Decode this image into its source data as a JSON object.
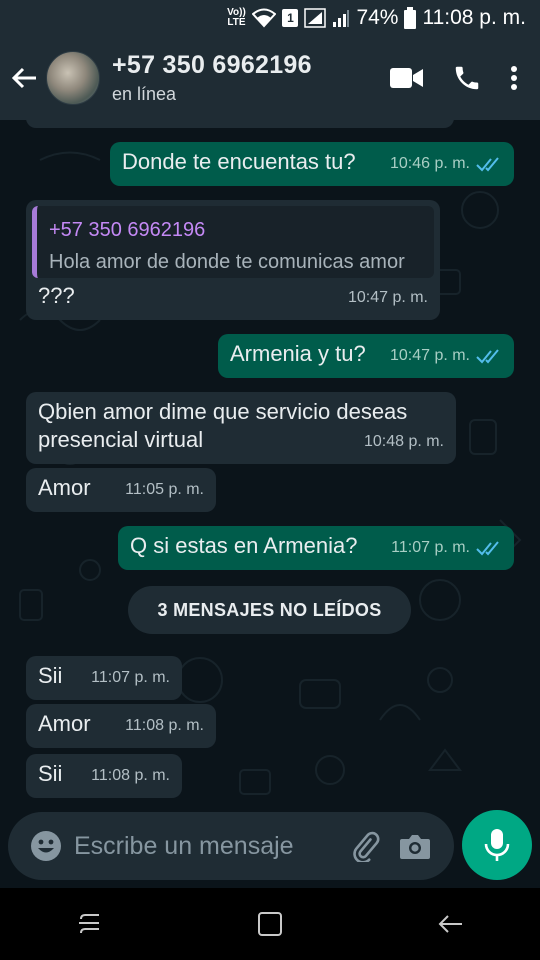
{
  "status_bar": {
    "volte_label": "Vo)) LTE",
    "sim_number": "1",
    "battery": "74%",
    "time": "11:08 p. m."
  },
  "header": {
    "contact_name": "+57 350 6962196",
    "contact_status": "en línea"
  },
  "messages": [
    {
      "dir": "out",
      "text": "Donde te encuentas tu?",
      "time": "10:46 p. m.",
      "ticks": "read"
    },
    {
      "dir": "in",
      "quote_name": "+57 350 6962196",
      "quote_text": "Hola amor de donde te comunicas amor",
      "text": "???",
      "time": "10:47 p. m."
    },
    {
      "dir": "out",
      "text": "Armenia y tu?",
      "time": "10:47 p. m.",
      "ticks": "read"
    },
    {
      "dir": "in",
      "text": "Qbien amor dime que servicio deseas presencial virtual",
      "time": "10:48 p. m."
    },
    {
      "dir": "in",
      "text": "Amor",
      "time": "11:05 p. m."
    },
    {
      "dir": "out",
      "text": "Q si estas en Armenia?",
      "time": "11:07 p. m.",
      "ticks": "read"
    },
    {
      "dir": "in",
      "text": "Sii",
      "time": "11:07 p. m."
    },
    {
      "dir": "in",
      "text": "Amor",
      "time": "11:08 p. m."
    },
    {
      "dir": "in",
      "text": "Sii",
      "time": "11:08 p. m."
    }
  ],
  "unread_divider": "3 MENSAJES NO LEÍDOS",
  "composer": {
    "placeholder": "Escribe un mensaje",
    "value": ""
  },
  "colors": {
    "incoming_bubble": "#1f2c34",
    "outgoing_bubble": "#005c4b",
    "accent": "#00a884",
    "read_tick": "#53bdeb",
    "quote_bar": "#a77bd8"
  },
  "icons": {
    "back": "arrow-left-icon",
    "video_call": "video-camera-icon",
    "voice_call": "phone-icon",
    "menu": "more-vertical-icon",
    "emoji": "emoji-icon",
    "attach": "paperclip-icon",
    "camera": "camera-icon",
    "mic": "microphone-icon"
  }
}
